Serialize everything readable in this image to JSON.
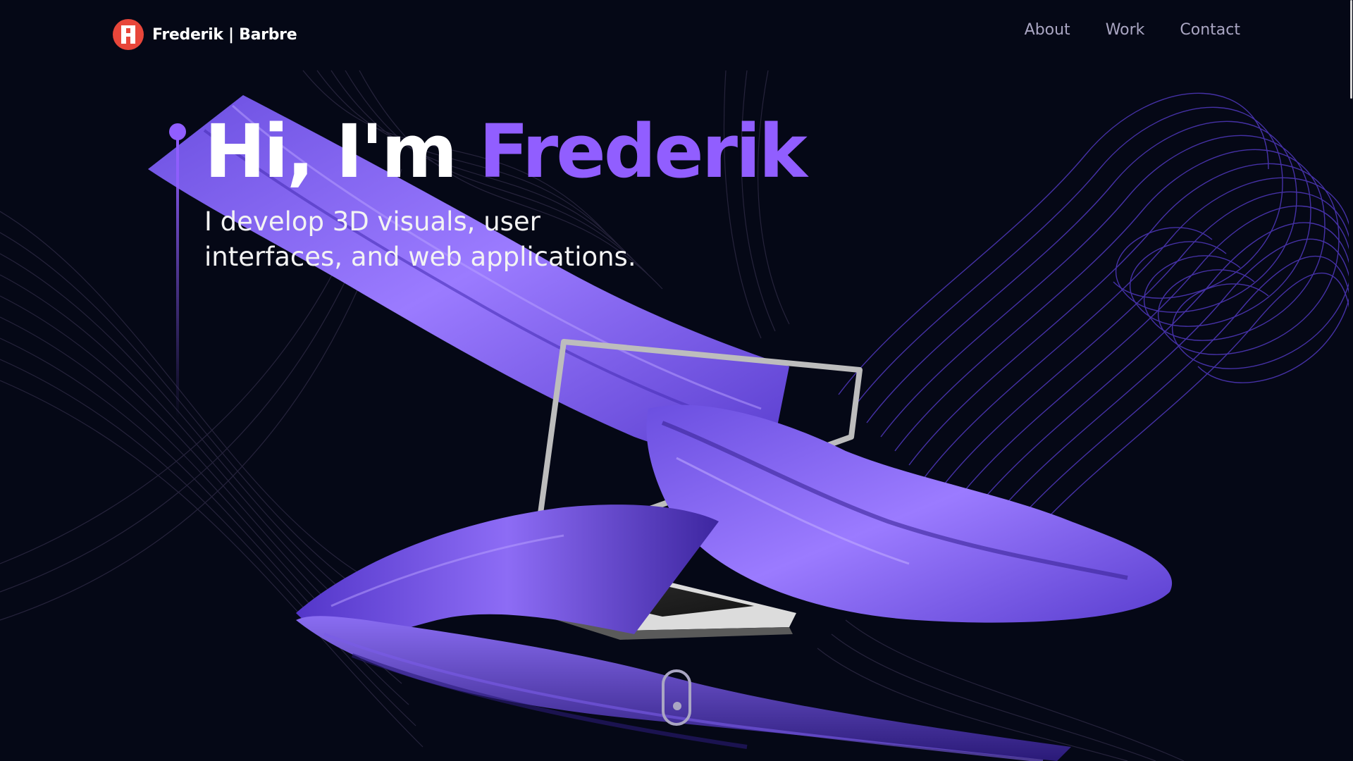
{
  "brand": {
    "name": "Frederik | Barbre",
    "logo_icon": "monogram-logo-icon",
    "logo_color": "#e8463a"
  },
  "nav": {
    "items": [
      {
        "label": "About"
      },
      {
        "label": "Work"
      },
      {
        "label": "Contact"
      }
    ]
  },
  "hero": {
    "greeting": "Hi, I'm ",
    "name": "Frederik",
    "subtitle_line1": "I develop 3D visuals, user",
    "subtitle_line2": "interfaces, and web applications."
  },
  "scroll_indicator": {
    "icon": "mouse-scroll-icon"
  },
  "colors": {
    "background": "#050816",
    "accent": "#915eff",
    "nav_text": "#aaa6c3",
    "text": "#ffffff"
  }
}
